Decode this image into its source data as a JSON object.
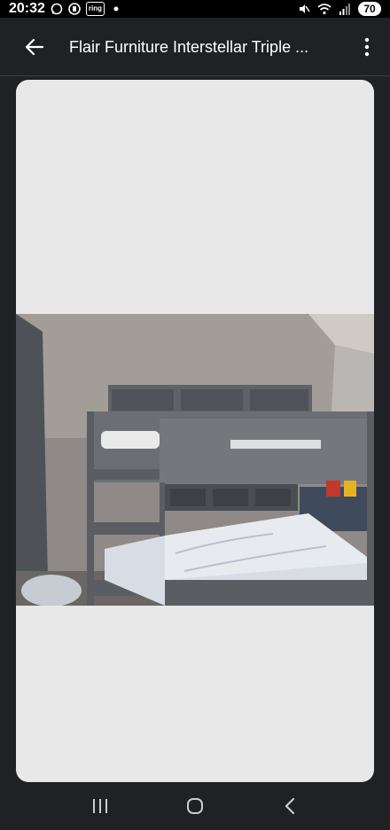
{
  "status_bar": {
    "time": "20:32",
    "ring_label": "ring",
    "battery": "70",
    "icons": [
      "whatsapp-icon",
      "messenger-icon",
      "ring-app-icon",
      "notification-dot",
      "mute-icon",
      "wifi-icon",
      "signal-icon",
      "battery-icon"
    ]
  },
  "app_bar": {
    "title": "Flair Furniture Interstellar Triple ...",
    "back_icon": "arrow-left-icon",
    "menu_icon": "more-vert-icon"
  },
  "image": {
    "subject": "grey triple bunk bed with shelves and mattresses",
    "background": "#e8e8e8"
  },
  "nav_bar": {
    "icons": [
      "recent-apps-icon",
      "home-icon",
      "back-icon"
    ]
  }
}
